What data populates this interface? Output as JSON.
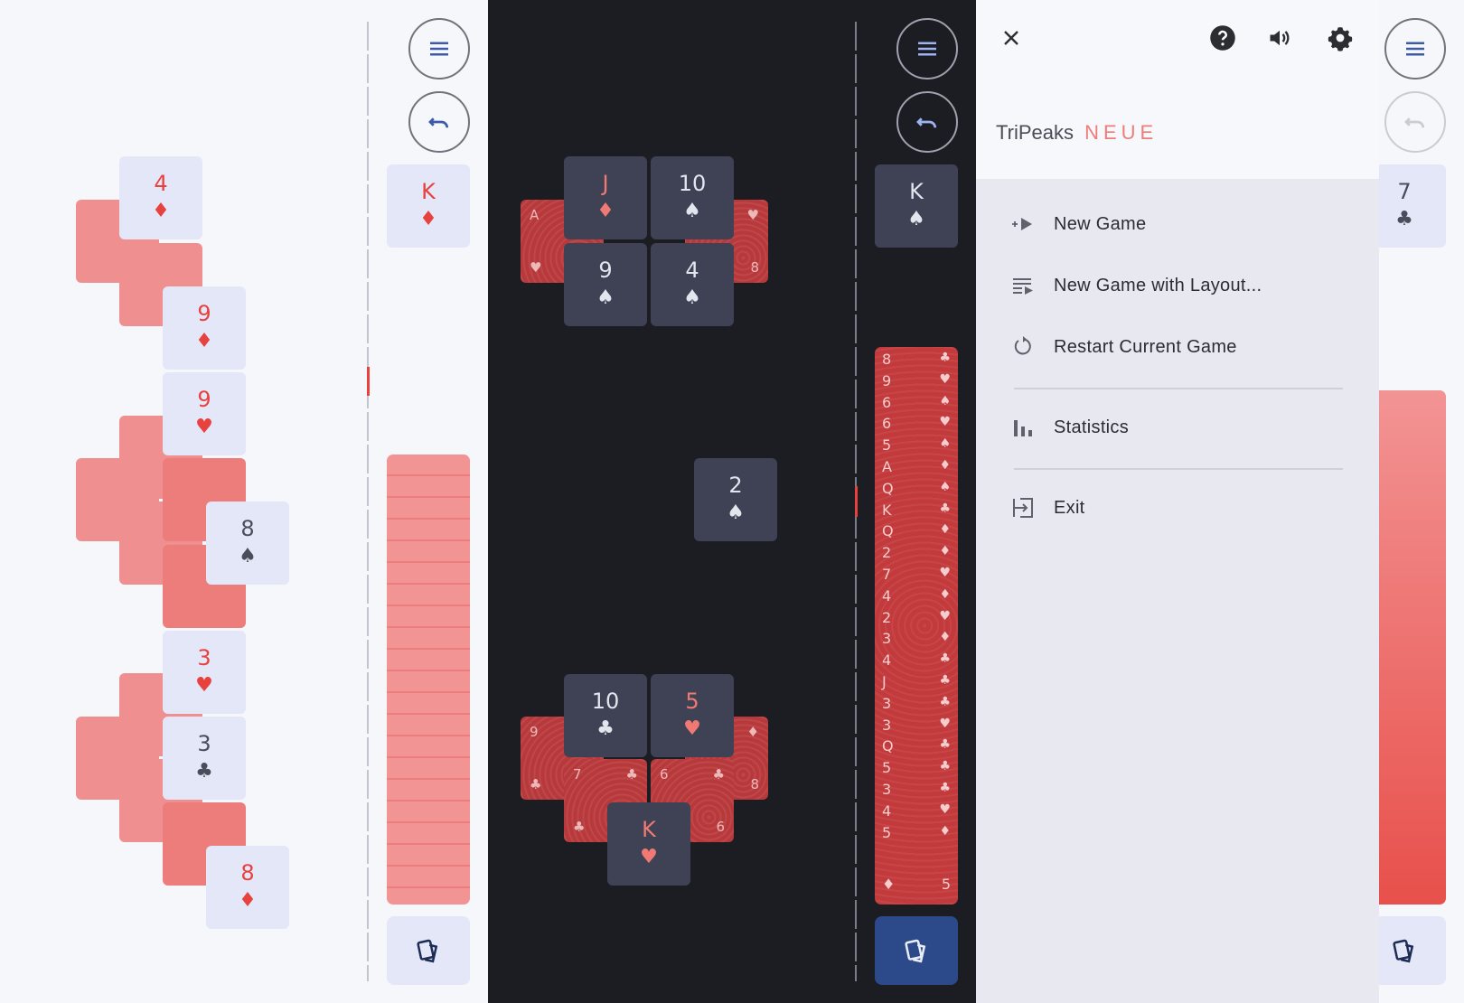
{
  "light": {
    "cards": [
      {
        "rank": "4",
        "suit": "♦",
        "color": "red"
      },
      {
        "rank": "9",
        "suit": "♦",
        "color": "red"
      },
      {
        "rank": "9",
        "suit": "♥",
        "color": "red"
      },
      {
        "rank": "8",
        "suit": "♠",
        "color": "black"
      },
      {
        "rank": "3",
        "suit": "♥",
        "color": "red"
      },
      {
        "rank": "3",
        "suit": "♣",
        "color": "black"
      },
      {
        "rank": "8",
        "suit": "♦",
        "color": "red"
      }
    ],
    "waste": {
      "rank": "K",
      "suit": "♦"
    }
  },
  "dark": {
    "cards": [
      {
        "rank": "J",
        "suit": "♦",
        "color": "red"
      },
      {
        "rank": "10",
        "suit": "♠",
        "color": "black"
      },
      {
        "rank": "9",
        "suit": "♠",
        "color": "black"
      },
      {
        "rank": "4",
        "suit": "♠",
        "color": "black"
      },
      {
        "rank": "2",
        "suit": "♠",
        "color": "black"
      },
      {
        "rank": "10",
        "suit": "♣",
        "color": "black"
      },
      {
        "rank": "5",
        "suit": "♥",
        "color": "red"
      },
      {
        "rank": "K",
        "suit": "♥",
        "color": "red"
      }
    ],
    "back_corners": [
      "A",
      "♥",
      "♥",
      "8",
      "9",
      "♣",
      "7",
      "♣",
      "♣",
      "6",
      "♣",
      "6",
      "♦",
      "8"
    ],
    "waste": {
      "rank": "K",
      "suit": "♠"
    },
    "stock": [
      {
        "rank": "8",
        "suit": "♣"
      },
      {
        "rank": "9",
        "suit": "♥"
      },
      {
        "rank": "6",
        "suit": "♠"
      },
      {
        "rank": "6",
        "suit": "♥"
      },
      {
        "rank": "5",
        "suit": "♠"
      },
      {
        "rank": "A",
        "suit": "♦"
      },
      {
        "rank": "Q",
        "suit": "♠"
      },
      {
        "rank": "K",
        "suit": "♣"
      },
      {
        "rank": "Q",
        "suit": "♦"
      },
      {
        "rank": "2",
        "suit": "♦"
      },
      {
        "rank": "7",
        "suit": "♥"
      },
      {
        "rank": "4",
        "suit": "♦"
      },
      {
        "rank": "2",
        "suit": "♥"
      },
      {
        "rank": "3",
        "suit": "♦"
      },
      {
        "rank": "4",
        "suit": "♣"
      },
      {
        "rank": "J",
        "suit": "♣"
      },
      {
        "rank": "3",
        "suit": "♣"
      },
      {
        "rank": "3",
        "suit": "♥"
      },
      {
        "rank": "Q",
        "suit": "♣"
      },
      {
        "rank": "5",
        "suit": "♣"
      },
      {
        "rank": "3",
        "suit": "♣"
      },
      {
        "rank": "4",
        "suit": "♥"
      },
      {
        "rank": "5",
        "suit": "♦"
      }
    ],
    "stock_bottom": {
      "suit": "♦",
      "rank": "5"
    }
  },
  "menu": {
    "app_name": "TriPeaks",
    "app_name_accent": "NEUE",
    "items": [
      {
        "label": "New Game",
        "icon": "play-forward-icon"
      },
      {
        "label": "New Game with Layout...",
        "icon": "playlist-play-icon"
      },
      {
        "label": "Restart Current Game",
        "icon": "restart-icon"
      },
      {
        "label": "Statistics",
        "icon": "bar-chart-icon"
      },
      {
        "label": "Exit",
        "icon": "exit-icon"
      }
    ],
    "behind_waste": {
      "rank": "7",
      "suit": "♣"
    }
  },
  "colors": {
    "accent_red": "#e8423f",
    "card_face_light": "#e4e7f8",
    "card_face_dark": "#3e4254",
    "dark_bg": "#1c1d22",
    "draw_button_dark": "#2c4a8a",
    "icon_blue": "#3d5aa8"
  }
}
